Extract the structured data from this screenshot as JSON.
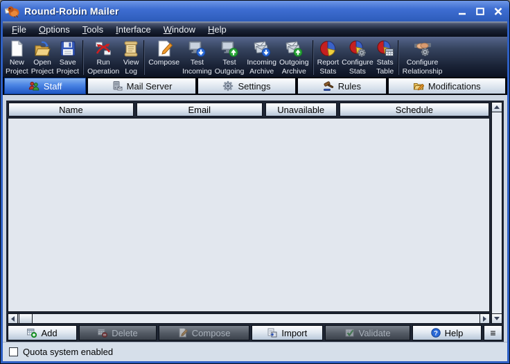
{
  "window": {
    "title": "Round-Robin Mailer",
    "app_icon": "robin-bird-icon",
    "controls": [
      {
        "name": "minimize-button",
        "icon": "minimize-icon"
      },
      {
        "name": "maximize-button",
        "icon": "maximize-icon"
      },
      {
        "name": "close-button",
        "icon": "close-icon"
      }
    ]
  },
  "menu_bar": {
    "items": [
      {
        "label": "File"
      },
      {
        "label": "Options"
      },
      {
        "label": "Tools"
      },
      {
        "label": "Interface"
      },
      {
        "label": "Window"
      },
      {
        "label": "Help"
      }
    ]
  },
  "toolbar": {
    "items": [
      {
        "label": "New\nProject",
        "icon": "new-project-icon"
      },
      {
        "label": "Open\nProject",
        "icon": "open-project-icon"
      },
      {
        "label": "Save\nProject",
        "icon": "save-project-icon"
      },
      {
        "label": "Run\nOperation",
        "icon": "run-operation-icon"
      },
      {
        "label": "View\nLog",
        "icon": "view-log-icon"
      },
      {
        "label": "Compose",
        "icon": "compose-icon"
      },
      {
        "label": "Test\nIncoming",
        "icon": "test-incoming-icon"
      },
      {
        "label": "Test\nOutgoing",
        "icon": "test-outgoing-icon"
      },
      {
        "label": "Incoming\nArchive",
        "icon": "incoming-archive-icon"
      },
      {
        "label": "Outgoing\nArchive",
        "icon": "outgoing-archive-icon"
      },
      {
        "label": "Report\nStats",
        "icon": "report-stats-icon"
      },
      {
        "label": "Configure\nStats",
        "icon": "configure-stats-icon"
      },
      {
        "label": "Stats\nTable",
        "icon": "stats-table-icon"
      },
      {
        "label": "Configure\nRelationship",
        "icon": "configure-relationship-icon"
      }
    ]
  },
  "tabs": {
    "items": [
      {
        "label": "Staff",
        "icon": "staff-icon",
        "selected": true
      },
      {
        "label": "Mail Server",
        "icon": "mail-server-icon",
        "selected": false
      },
      {
        "label": "Settings",
        "icon": "settings-icon",
        "selected": false
      },
      {
        "label": "Rules",
        "icon": "rules-icon",
        "selected": false
      },
      {
        "label": "Modifications",
        "icon": "modifications-icon",
        "selected": false
      }
    ]
  },
  "staff_table": {
    "columns": [
      "Name",
      "Email",
      "Unavailable",
      "Schedule"
    ],
    "rows": []
  },
  "action_bar": {
    "buttons": [
      {
        "label": "Add",
        "icon": "add-icon",
        "enabled": true
      },
      {
        "label": "Delete",
        "icon": "delete-icon",
        "enabled": false
      },
      {
        "label": "Compose",
        "icon": "compose-small-icon",
        "enabled": false
      },
      {
        "label": "Import",
        "icon": "import-icon",
        "enabled": true
      },
      {
        "label": "Validate",
        "icon": "validate-icon",
        "enabled": false
      },
      {
        "label": "Help",
        "icon": "help-icon",
        "enabled": true
      }
    ],
    "list_menu_glyph": "≡"
  },
  "status_bar": {
    "quota_checkbox": {
      "label": "Quota system enabled",
      "checked": false
    }
  },
  "colors": {
    "titlebar_blue": "#3e6ed2",
    "selected_tab_blue": "#2f6ad4",
    "toolbar_dark": "#1b2438",
    "panel_dark": "#1e2533",
    "table_body": "#e2e7ee",
    "workspace_bg": "#cdd6e2",
    "disabled_button": "#555c66",
    "accent_red": "#cc2222",
    "accent_green": "#2aa53a",
    "accent_blue_circle": "#2a6ad8"
  }
}
